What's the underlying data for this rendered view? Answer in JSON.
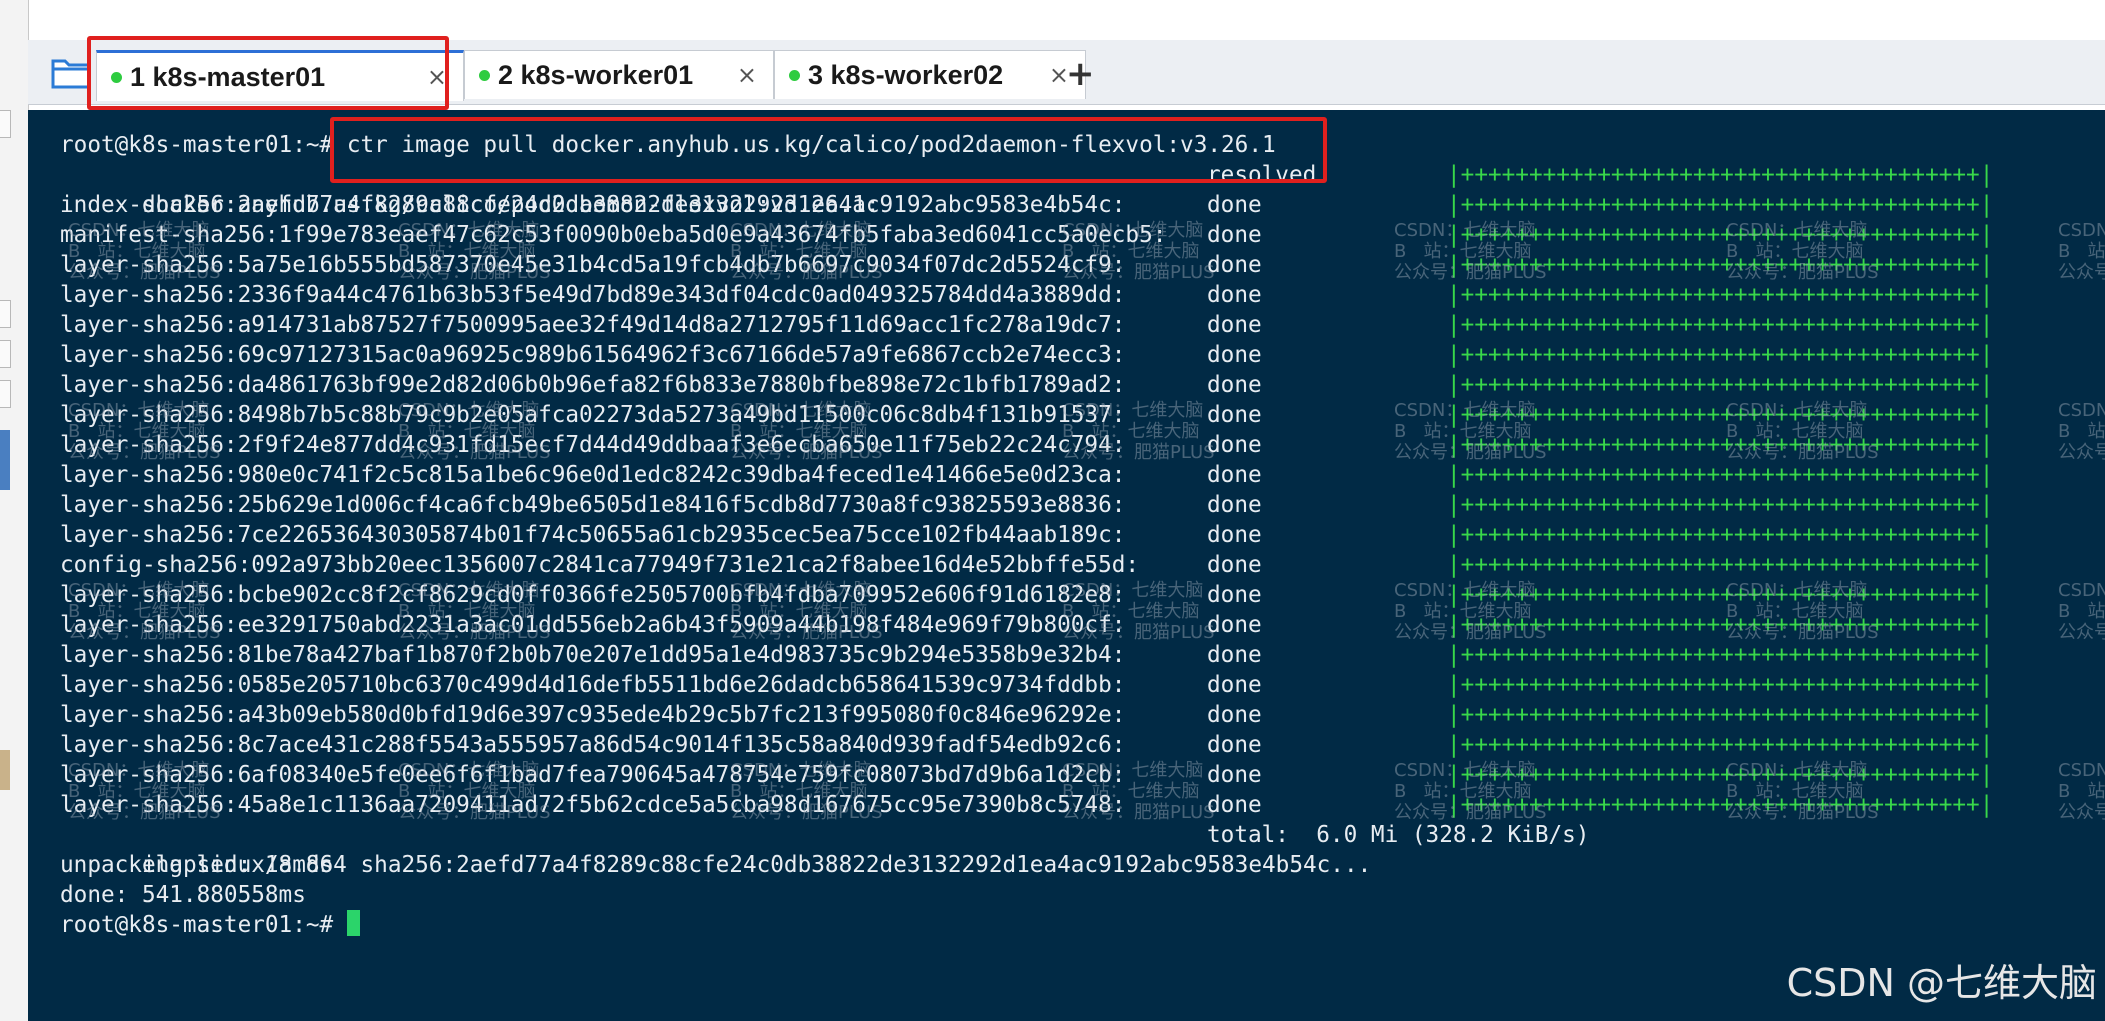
{
  "tabs": [
    {
      "label": "1 k8s-master01",
      "close": "×",
      "status_color": "#2ecc40"
    },
    {
      "label": "2 k8s-worker01",
      "close": "×",
      "status_color": "#2ecc40"
    },
    {
      "label": "3 k8s-worker02",
      "close": "×",
      "status_color": "#2ecc40"
    }
  ],
  "new_tab": "+",
  "terminal": {
    "prompt_line": "root@k8s-master01:~# ctr image pull docker.anyhub.us.kg/calico/pod2daemon-flexvol:v3.26.1",
    "ref_line": "docker.anyhub.us.kg/calico/pod2daemon-flexvol:v3.26.1:",
    "ref_status": "resolved",
    "progress_bar": "|++++++++++++++++++++++++++++++++++++++|",
    "layers": [
      {
        "name": "index-sha256:2aefd77a4f8289c88cfe24c0db38822de3132292d1ea4ac9192abc9583e4b54c:",
        "status": "done"
      },
      {
        "name": "manifest-sha256:1f99e783eaef47c62c53f0090b0eba5d0e9a43674fb5faba3ed6041cc5a0ecb5:",
        "status": "done"
      },
      {
        "name": "layer-sha256:5a75e16b555bd587370e45e31b4cd5a19fcb4db7b6697c9034f07dc2d5524cf9:",
        "status": "done"
      },
      {
        "name": "layer-sha256:2336f9a44c4761b63b53f5e49d7bd89e343df04cdc0ad049325784dd4a3889dd:",
        "status": "done"
      },
      {
        "name": "layer-sha256:a914731ab87527f7500995aee32f49d14d8a2712795f11d69acc1fc278a19dc7:",
        "status": "done"
      },
      {
        "name": "layer-sha256:69c97127315ac0a96925c989b61564962f3c67166de57a9fe6867ccb2e74ecc3:",
        "status": "done"
      },
      {
        "name": "layer-sha256:da4861763bf99e2d82d06b0b96efa82f6b833e7880bfbe898e72c1bfb1789ad2:",
        "status": "done"
      },
      {
        "name": "layer-sha256:8498b7b5c88b79c9b2e05afca02273da5273a49bd11500c06c8db4f131b91537:",
        "status": "done"
      },
      {
        "name": "layer-sha256:2f9f24e877dd4c931fd15ecf7d44d49ddbaaf3e6ecba650e11f75eb22c24c794:",
        "status": "done"
      },
      {
        "name": "layer-sha256:980e0c741f2c5c815a1be6c96e0d1edc8242c39dba4feced1e41466e5e0d23ca:",
        "status": "done"
      },
      {
        "name": "layer-sha256:25b629e1d006cf4ca6fcb49be6505d1e8416f5cdb8d7730a8fc93825593e8836:",
        "status": "done"
      },
      {
        "name": "layer-sha256:7ce226536430305874b01f74c50655a61cb2935cec5ea75cce102fb44aab189c:",
        "status": "done"
      },
      {
        "name": "config-sha256:092a973bb20eec1356007c2841ca77949f731e21ca2f8abee16d4e52bbffe55d:",
        "status": "done"
      },
      {
        "name": "layer-sha256:bcbe902cc8f2cf8629cd0ff0366fe2505700bfb4fdba709952e606f91d6182e8:",
        "status": "done"
      },
      {
        "name": "layer-sha256:ee3291750abd2231a3ac01dd556eb2a6b43f5909a44b198f484e969f79b800cf:",
        "status": "done"
      },
      {
        "name": "layer-sha256:81be78a427baf1b870f2b0b70e207e1dd95a1e4d983735c9b294e5358b9e32b4:",
        "status": "done"
      },
      {
        "name": "layer-sha256:0585e205710bc6370c499d4d16defb5511bd6e26dadcb658641539c9734fddbb:",
        "status": "done"
      },
      {
        "name": "layer-sha256:a43b09eb580d0bfd19d6e397c935ede4b29c5b7fc213f995080f0c846e96292e:",
        "status": "done"
      },
      {
        "name": "layer-sha256:8c7ace431c288f5543a555957a86d54c9014f135c58a840d939fadf54edb92c6:",
        "status": "done"
      },
      {
        "name": "layer-sha256:6af08340e5fe0ee6f6f1bad7fea790645a478754e759fc08073bd7d9b6a1d2cb:",
        "status": "done"
      },
      {
        "name": "layer-sha256:45a8e1c1136aa7209411ad72f5b62cdce5a5cba98d167675cc95e7390b8c5748:",
        "status": "done"
      }
    ],
    "elapsed": "elapsed: 18.8s",
    "total": "total:  6.0 Mi (328.2 KiB/s)",
    "unpacking": "unpacking linux/amd64 sha256:2aefd77a4f8289c88cfe24c0db38822de3132292d1ea4ac9192abc9583e4b54c...",
    "done_line": "done: 541.880558ms",
    "final_prompt": "root@k8s-master01:~# "
  },
  "watermark": "CSDN：七维大脑\nB   站：七维大脑\n公众号：肥猫PLUS",
  "brand": "CSDN @七维大脑",
  "colors": {
    "terminal_bg": "#012a45",
    "progress": "#38d84a",
    "highlight": "#e0201e",
    "active_tab_accent": "#2d6fd6"
  }
}
